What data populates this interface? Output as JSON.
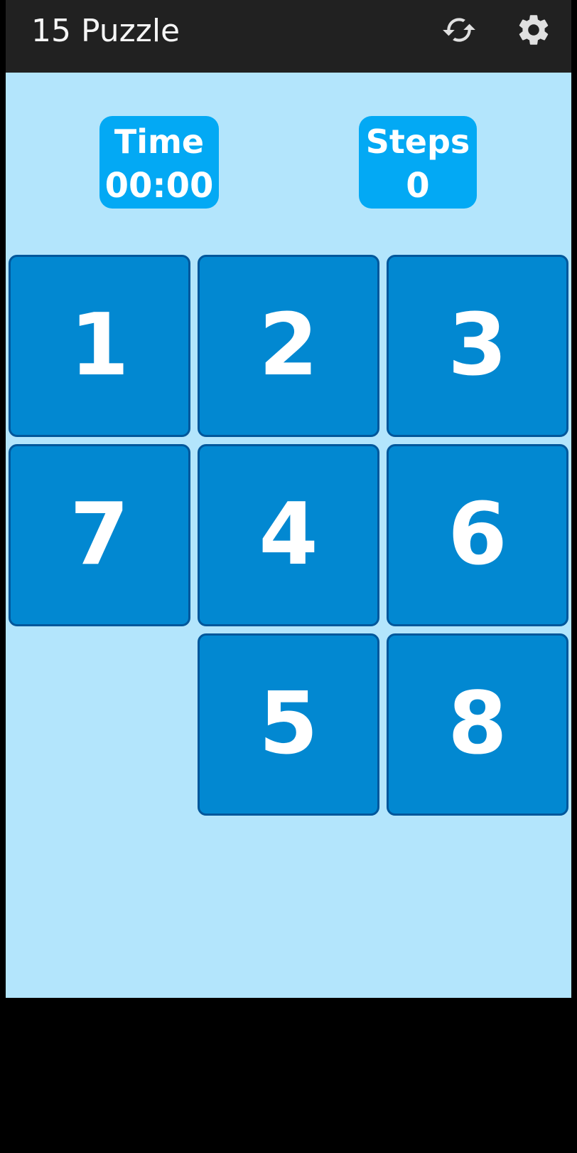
{
  "app_bar": {
    "title": "15 Puzzle",
    "refresh_icon": "refresh-icon",
    "settings_icon": "gear-icon",
    "background": "#212121"
  },
  "stats": {
    "time": {
      "label": "Time",
      "value": "00:00"
    },
    "steps": {
      "label": "Steps",
      "value": "0"
    }
  },
  "board": {
    "rows": 3,
    "cols": 3,
    "tiles": [
      "1",
      "2",
      "3",
      "7",
      "4",
      "6",
      "",
      "5",
      "8"
    ]
  },
  "colors": {
    "background": "#b3e5fc",
    "stat_box": "#03a9f4",
    "tile": "#0288d1",
    "tile_border": "#01579b",
    "text": "#ffffff"
  }
}
